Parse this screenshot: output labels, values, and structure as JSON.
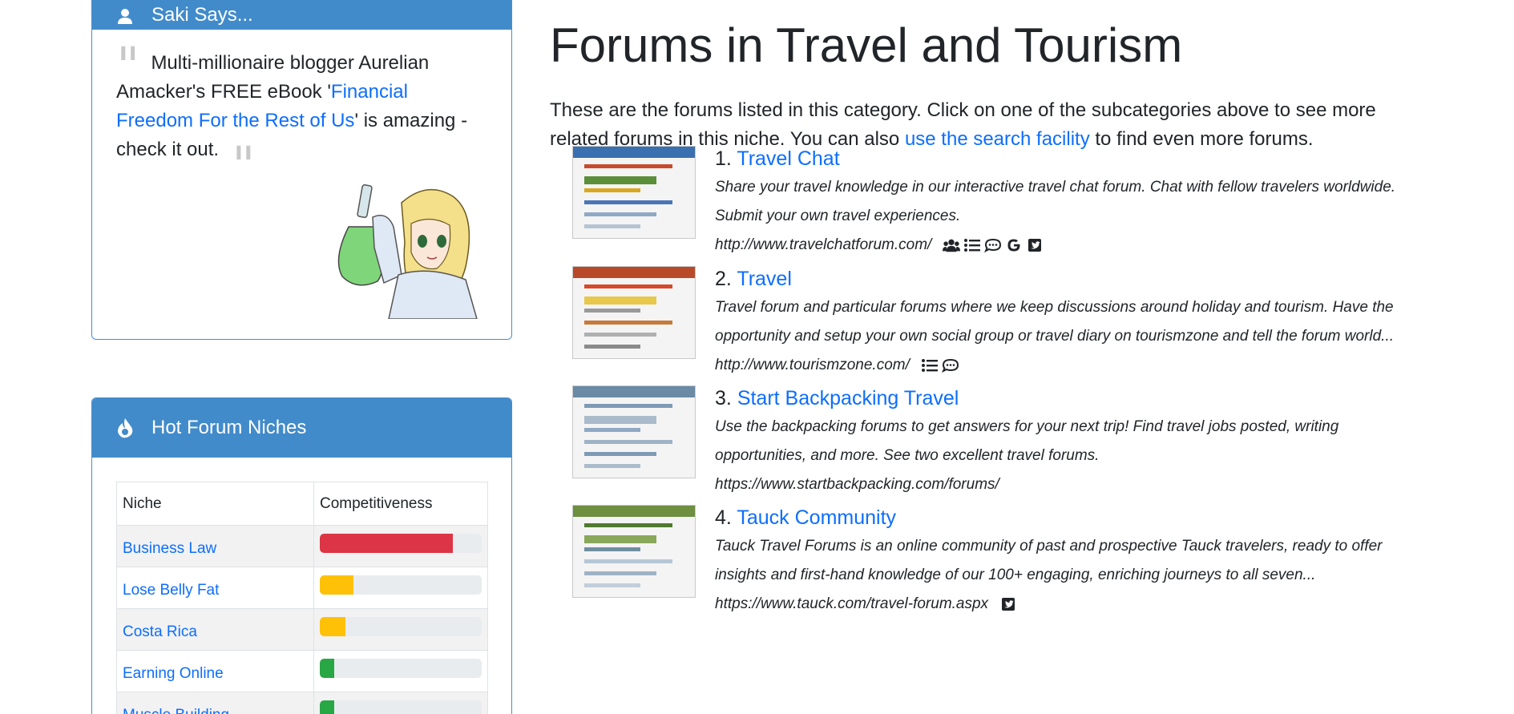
{
  "sidebar": {
    "saki": {
      "header": "Saki Says...",
      "quote_text_1": "Multi-millionaire blogger Aurelian Amacker's FREE eBook '",
      "quote_link": "Financial Freedom For the Rest of Us",
      "quote_text_2": "' is amazing - check it out."
    },
    "hot_niches": {
      "header": "Hot Forum Niches",
      "col_niche": "Niche",
      "col_competitiveness": "Competitiveness",
      "rows": [
        {
          "name": "Business Law",
          "level": 0.82,
          "color": "#dc3545"
        },
        {
          "name": "Lose Belly Fat",
          "level": 0.21,
          "color": "#ffc107"
        },
        {
          "name": "Costa Rica",
          "level": 0.16,
          "color": "#ffc107"
        },
        {
          "name": "Earning Online",
          "level": 0.09,
          "color": "#28a745"
        },
        {
          "name": "Muscle Building",
          "level": 0.09,
          "color": "#28a745"
        }
      ]
    }
  },
  "main": {
    "title": "Forums in Travel and Tourism",
    "intro_1": "These are the forums listed in this category. Click on one of the subcategories above to see more related forums in this niche. You can also ",
    "intro_link": "use the search facility",
    "intro_2": " to find even more forums.",
    "forums": [
      {
        "number": "1.",
        "name": "Travel Chat",
        "description": "Share your travel knowledge in our interactive travel chat forum. Chat with fellow travelers worldwide. Submit your own travel experiences.",
        "url": "http://www.travelchatforum.com/",
        "icons": [
          "users-icon",
          "list-icon",
          "comment-icon",
          "google-icon",
          "twitter-square-icon"
        ]
      },
      {
        "number": "2.",
        "name": "Travel",
        "description": "Travel forum and particular forums where we keep discussions around holiday and tourism. Have the opportunity and setup your own social group or travel diary on tourismzone and tell the forum world...",
        "url": "http://www.tourismzone.com/",
        "icons": [
          "list-icon",
          "comment-icon"
        ]
      },
      {
        "number": "3.",
        "name": "Start Backpacking Travel",
        "description": "Use the backpacking forums to get answers for your next trip! Find travel jobs posted, writing opportunities, and more. See two excellent travel forums.",
        "url": "https://www.startbackpacking.com/forums/",
        "icons": []
      },
      {
        "number": "4.",
        "name": "Tauck Community",
        "description": "Tauck Travel Forums is an online community of past and prospective Tauck travelers, ready to offer insights and first-hand knowledge of our 100+ engaging, enriching journeys to all seven...",
        "url": "https://www.tauck.com/travel-forum.aspx",
        "icons": [
          "twitter-square-icon"
        ]
      }
    ]
  },
  "colors": {
    "accent": "#428bca",
    "link": "#0d6efd"
  }
}
